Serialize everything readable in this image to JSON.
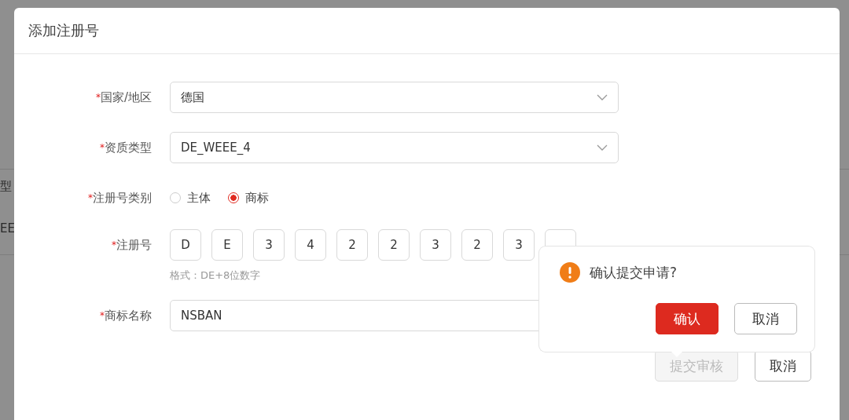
{
  "background": {
    "fragments": [
      "型",
      "EE"
    ]
  },
  "dialog": {
    "title": "添加注册号",
    "fields": [
      {
        "kind": "select",
        "mark": "*",
        "label": "国家/地区",
        "value": "德国"
      },
      {
        "kind": "select",
        "mark": "*",
        "label": "资质类型",
        "value": "DE_WEEE_4"
      },
      {
        "kind": "radio",
        "mark": "*",
        "label": "注册号类别",
        "options": [
          {
            "label": "主体",
            "selected": false
          },
          {
            "label": "商标",
            "selected": true
          }
        ]
      },
      {
        "kind": "code",
        "mark": "*",
        "label": "注册号",
        "chars": [
          "D",
          "E",
          "3",
          "4",
          "2",
          "2",
          "3",
          "2",
          "3"
        ],
        "hint": "格式：DE+8位数字"
      },
      {
        "kind": "text",
        "mark": "*",
        "label": "商标名称",
        "value": "NSBAN"
      }
    ],
    "buttons": [
      {
        "label": "提交审核",
        "disabled": true
      },
      {
        "label": "取消",
        "disabled": false
      }
    ]
  },
  "popconfirm": {
    "message": "确认提交申请?",
    "buttons": [
      {
        "label": "确认",
        "kind": "primary"
      },
      {
        "label": "取消",
        "kind": "default"
      }
    ]
  }
}
